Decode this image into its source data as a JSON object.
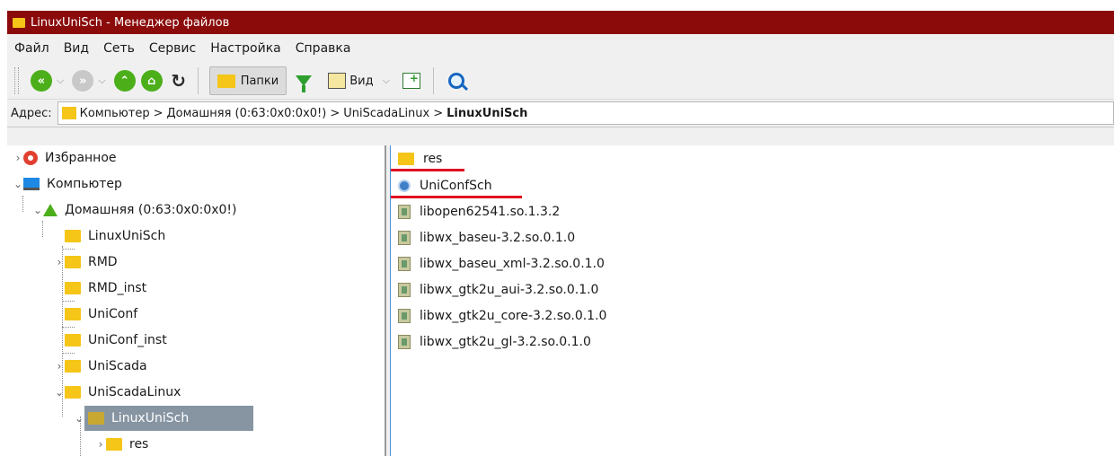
{
  "window": {
    "title": "LinuxUniSch - Менеджер файлов"
  },
  "menu": [
    "Файл",
    "Вид",
    "Сеть",
    "Сервис",
    "Настройка",
    "Справка"
  ],
  "toolbar": {
    "folders_label": "Папки",
    "view_label": "Вид"
  },
  "address": {
    "label": "Адрес:",
    "crumbs": [
      "Компьютер",
      "Домашняя (0:63:0x0:0x0!)",
      "UniScadaLinux"
    ],
    "current": "LinuxUniSch",
    "sep": ">"
  },
  "tree": [
    {
      "label": "Избранное",
      "icon": "heart-icon"
    },
    {
      "label": "Компьютер",
      "icon": "computer-icon"
    },
    {
      "label": "Домашняя (0:63:0x0:0x0!)",
      "icon": "home-icon"
    },
    {
      "label": "LinuxUniSch",
      "icon": "folder-icon"
    },
    {
      "label": "RMD",
      "icon": "folder-icon"
    },
    {
      "label": "RMD_inst",
      "icon": "folder-icon"
    },
    {
      "label": "UniConf",
      "icon": "folder-icon"
    },
    {
      "label": "UniConf_inst",
      "icon": "folder-icon"
    },
    {
      "label": "UniScada",
      "icon": "folder-icon"
    },
    {
      "label": "UniScadaLinux",
      "icon": "folder-icon"
    },
    {
      "label": "LinuxUniSch",
      "icon": "folder-icon",
      "selected": true
    },
    {
      "label": "res",
      "icon": "folder-icon"
    }
  ],
  "files": [
    {
      "name": "res",
      "icon": "folder-icon"
    },
    {
      "name": "UniConfSch",
      "icon": "app-icon"
    },
    {
      "name": "libopen62541.so.1.3.2",
      "icon": "library-icon"
    },
    {
      "name": "libwx_baseu-3.2.so.0.1.0",
      "icon": "library-icon"
    },
    {
      "name": "libwx_baseu_xml-3.2.so.0.1.0",
      "icon": "library-icon"
    },
    {
      "name": "libwx_gtk2u_aui-3.2.so.0.1.0",
      "icon": "library-icon"
    },
    {
      "name": "libwx_gtk2u_core-3.2.so.0.1.0",
      "icon": "library-icon"
    },
    {
      "name": "libwx_gtk2u_gl-3.2.so.0.1.0",
      "icon": "library-icon"
    }
  ],
  "colors": {
    "titlebar": "#8b0b0b",
    "selection": "#8795a3",
    "highlight": "#e01020",
    "folder": "#f5c518"
  }
}
